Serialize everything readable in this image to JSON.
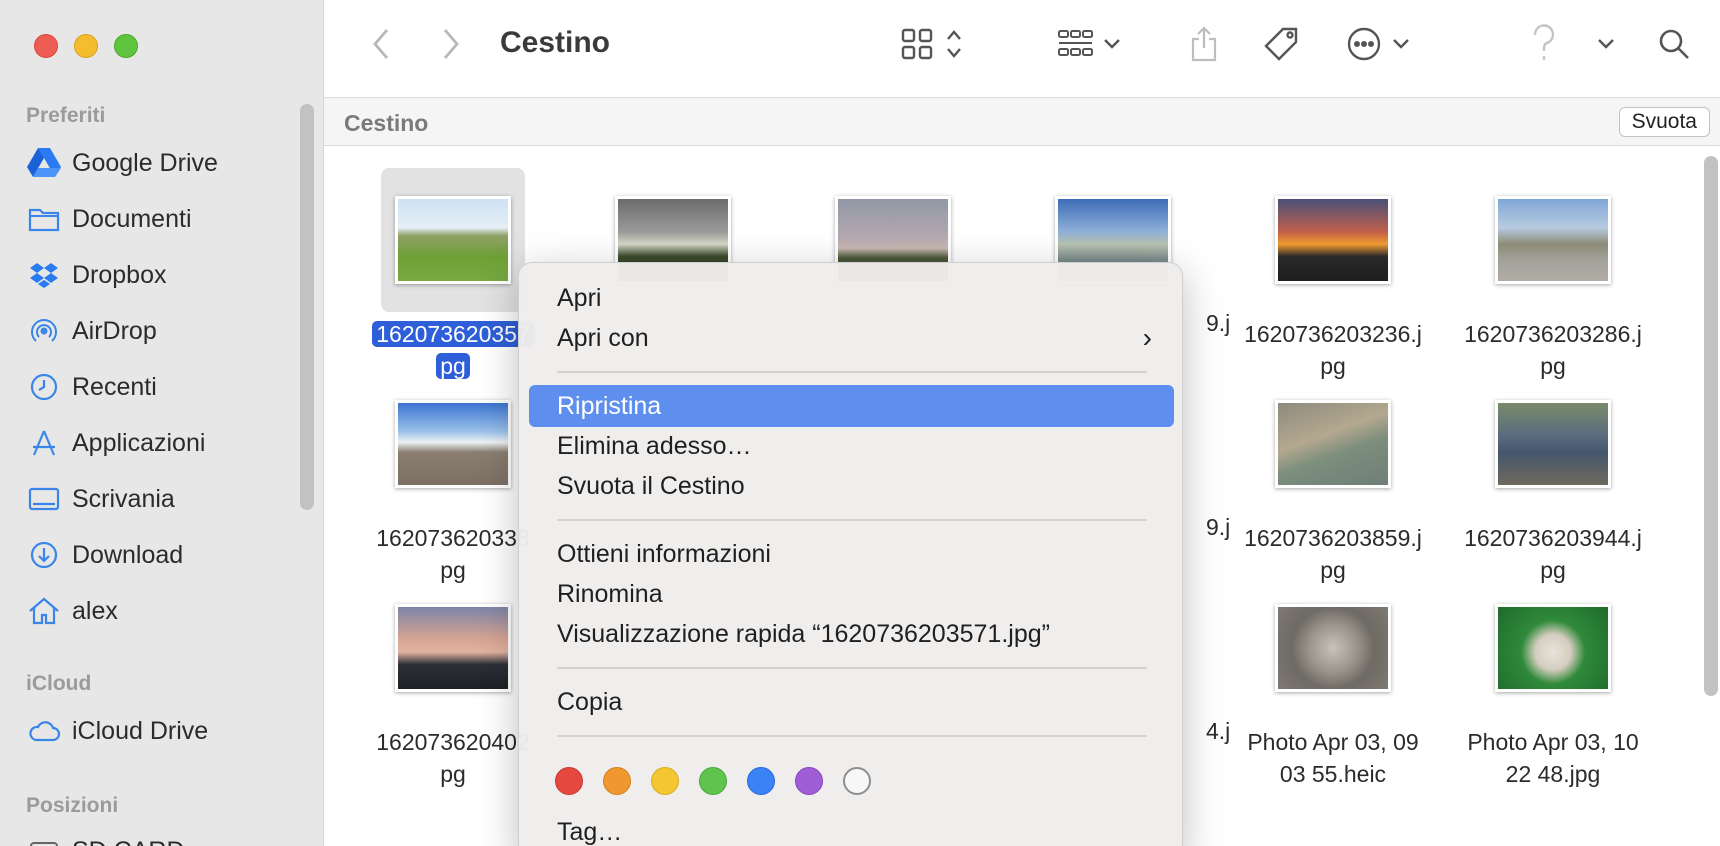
{
  "window": {
    "title": "Cestino"
  },
  "sidebar": {
    "sections": {
      "favorites": "Preferiti",
      "icloud": "iCloud",
      "locations": "Posizioni"
    },
    "favorites": [
      {
        "label": "Google Drive",
        "icon": "google-drive-icon"
      },
      {
        "label": "Documenti",
        "icon": "folder-icon"
      },
      {
        "label": "Dropbox",
        "icon": "dropbox-icon"
      },
      {
        "label": "AirDrop",
        "icon": "airdrop-icon"
      },
      {
        "label": "Recenti",
        "icon": "clock-icon"
      },
      {
        "label": "Applicazioni",
        "icon": "applications-icon"
      },
      {
        "label": "Scrivania",
        "icon": "desktop-icon"
      },
      {
        "label": "Download",
        "icon": "download-icon"
      },
      {
        "label": "alex",
        "icon": "home-icon"
      }
    ],
    "icloud": [
      {
        "label": "iCloud Drive",
        "icon": "cloud-icon"
      }
    ],
    "locations": [
      {
        "label": "SD CARD",
        "icon": "drive-icon"
      }
    ]
  },
  "pathbar": {
    "title": "Cestino",
    "empty_button": "Svuota"
  },
  "files": [
    {
      "line1": "162073620357",
      "line2": "pg",
      "selected": true
    },
    {
      "line1": "",
      "line2": ""
    },
    {
      "line1": "",
      "line2": ""
    },
    {
      "line1": "9.j",
      "line2": ""
    },
    {
      "line1": "1620736203236.j",
      "line2": "pg"
    },
    {
      "line1": "1620736203286.j",
      "line2": "pg"
    },
    {
      "line1": "162073620338",
      "line2": "pg"
    },
    {
      "line1": "9.j",
      "line2": ""
    },
    {
      "line1": "1620736203859.j",
      "line2": "pg"
    },
    {
      "line1": "1620736203944.j",
      "line2": "pg"
    },
    {
      "line1": "162073620402",
      "line2": "pg"
    },
    {
      "line1": "4.j",
      "line2": ""
    },
    {
      "line1": "Photo Apr 03, 09",
      "line2": "03 55.heic"
    },
    {
      "line1": "Photo Apr 03, 10",
      "line2": "22 48.jpg"
    }
  ],
  "context_menu": {
    "items": [
      "Apri",
      "Apri con",
      "Ripristina",
      "Elimina adesso…",
      "Svuota il Cestino",
      "Ottieni informazioni",
      "Rinomina",
      "Visualizzazione rapida “1620736203571.jpg”",
      "Copia",
      "Tag…"
    ],
    "highlighted": "Ripristina",
    "tag_colors": [
      "#e4483f",
      "#f0972f",
      "#f4c631",
      "#5ec44d",
      "#3b82f6",
      "#a05ed6",
      "#ffffff"
    ]
  }
}
